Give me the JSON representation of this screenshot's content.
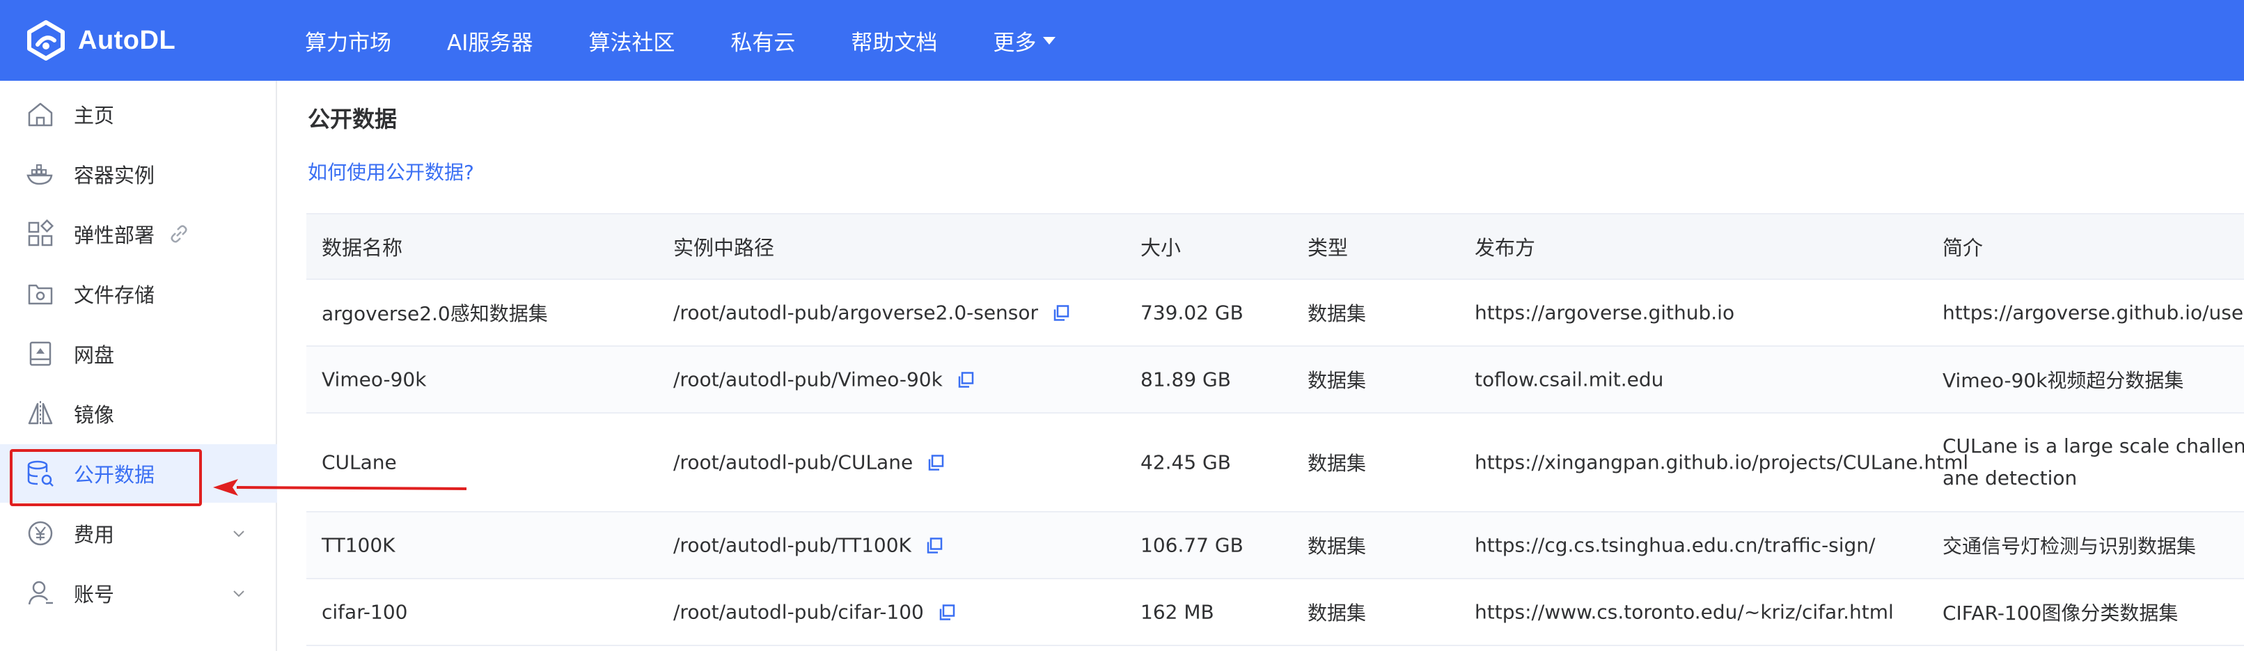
{
  "brand": {
    "name": "AutoDL",
    "color": "#3a6ff3"
  },
  "nav": [
    {
      "label": "算力市场"
    },
    {
      "label": "AI服务器"
    },
    {
      "label": "算法社区"
    },
    {
      "label": "私有云"
    },
    {
      "label": "帮助文档"
    },
    {
      "label": "更多"
    }
  ],
  "sidebar": {
    "items": [
      {
        "label": "主页",
        "icon": "home-icon"
      },
      {
        "label": "容器实例",
        "icon": "container-icon"
      },
      {
        "label": "弹性部署",
        "icon": "apps-icon"
      },
      {
        "label": "文件存储",
        "icon": "storage-icon"
      },
      {
        "label": "网盘",
        "icon": "disk-icon"
      },
      {
        "label": "镜像",
        "icon": "mirror-icon"
      },
      {
        "label": "公开数据",
        "icon": "database-search-icon",
        "active": true
      },
      {
        "label": "费用",
        "icon": "yen-icon"
      },
      {
        "label": "账号",
        "icon": "user-icon"
      }
    ]
  },
  "main": {
    "title": "公开数据",
    "help_link": "如何使用公开数据?",
    "table": {
      "headers": [
        "数据名称",
        "实例中路径",
        "大小",
        "类型",
        "发布方",
        "简介"
      ],
      "rows": [
        {
          "name": "argoverse2.0感知数据集",
          "path": "/root/autodl-pub/argoverse2.0-sensor",
          "size": "739.02 GB",
          "type": "数据集",
          "publisher": "https://argoverse.github.io",
          "intro": "https://argoverse.github.io/user-gui"
        },
        {
          "name": "Vimeo-90k",
          "path": "/root/autodl-pub/Vimeo-90k",
          "size": "81.89 GB",
          "type": "数据集",
          "publisher": "toflow.csail.mit.edu",
          "intro": "Vimeo-90k视频超分数据集"
        },
        {
          "name": "CULane",
          "path": "/root/autodl-pub/CULane",
          "size": "42.45 GB",
          "type": "数据集",
          "publisher": "https://xingangpan.github.io/projects/CULane.html",
          "intro": "CULane is a large scale challengin ane detection"
        },
        {
          "name": "TT100K",
          "path": "/root/autodl-pub/TT100K",
          "size": "106.77 GB",
          "type": "数据集",
          "publisher": "https://cg.cs.tsinghua.edu.cn/traffic-sign/",
          "intro": "交通信号灯检测与识别数据集"
        },
        {
          "name": "cifar-100",
          "path": "/root/autodl-pub/cifar-100",
          "size": "162 MB",
          "type": "数据集",
          "publisher": "https://www.cs.toronto.edu/~kriz/cifar.html",
          "intro": "CIFAR-100图像分类数据集"
        }
      ]
    }
  },
  "annotation": {
    "color": "#e02020"
  }
}
